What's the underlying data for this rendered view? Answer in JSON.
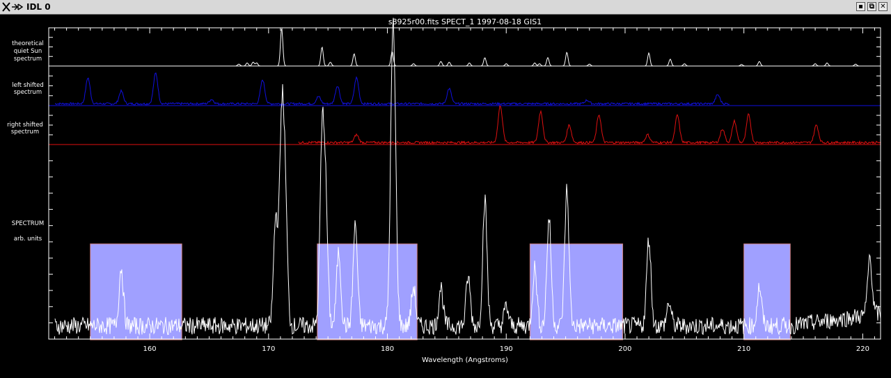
{
  "window": {
    "title": "IDL 0",
    "icon": "X-cross-window-icon",
    "buttons": [
      "minimize-icon",
      "restore-icon",
      "close-icon"
    ],
    "button_glyphs": {
      "minimize": "▪",
      "restore": "⧉",
      "close": "✕"
    }
  },
  "chart_data": {
    "type": "line",
    "title": "s8925r00.fits SPECT_1 1997-08-18 GIS1",
    "xlabel": "Wavelength (Angstroms)",
    "xlim": [
      151.5,
      221.5
    ],
    "xticks": [
      160,
      170,
      180,
      190,
      200,
      210,
      220
    ],
    "xtick_labels": [
      "160",
      "170",
      "180",
      "190",
      "200",
      "210",
      "220"
    ],
    "panels": [
      {
        "name": "theoretical",
        "label_lines": [
          "theoretical",
          "quiet Sun",
          "spectrum"
        ],
        "color": "#ffffff",
        "x_range": [
          151.5,
          221.5
        ],
        "lines": [
          [
            167.5,
            0.05
          ],
          [
            168.2,
            0.08
          ],
          [
            168.7,
            0.1
          ],
          [
            169.0,
            0.08
          ],
          [
            171.1,
            1.0
          ],
          [
            174.5,
            0.5
          ],
          [
            175.2,
            0.1
          ],
          [
            177.2,
            0.32
          ],
          [
            180.4,
            0.38
          ],
          [
            182.2,
            0.06
          ],
          [
            184.5,
            0.12
          ],
          [
            185.2,
            0.1
          ],
          [
            186.9,
            0.08
          ],
          [
            188.2,
            0.22
          ],
          [
            190.0,
            0.06
          ],
          [
            192.4,
            0.08
          ],
          [
            192.8,
            0.06
          ],
          [
            193.5,
            0.22
          ],
          [
            195.1,
            0.36
          ],
          [
            197.0,
            0.05
          ],
          [
            202.0,
            0.34
          ],
          [
            203.8,
            0.18
          ],
          [
            205.0,
            0.06
          ],
          [
            209.8,
            0.04
          ],
          [
            211.3,
            0.12
          ],
          [
            216.0,
            0.06
          ],
          [
            217.0,
            0.08
          ],
          [
            219.4,
            0.05
          ]
        ]
      },
      {
        "name": "left-shifted",
        "label_lines": [
          "left shifted",
          "spectrum"
        ],
        "color": "#1010e0",
        "x_range": [
          152.0,
          208.8
        ],
        "lines": [
          [
            154.8,
            0.72
          ],
          [
            157.6,
            0.35
          ],
          [
            160.5,
            0.85
          ],
          [
            165.2,
            0.12
          ],
          [
            169.5,
            0.66
          ],
          [
            174.2,
            0.2
          ],
          [
            175.8,
            0.5
          ],
          [
            177.4,
            0.72
          ],
          [
            185.2,
            0.42
          ],
          [
            196.8,
            0.1
          ],
          [
            207.8,
            0.25
          ]
        ]
      },
      {
        "name": "right-shifted",
        "label_lines": [
          "right shifted",
          "spectrum"
        ],
        "color": "#e01010",
        "x_range": [
          172.5,
          221.5
        ],
        "lines": [
          [
            177.4,
            0.2
          ],
          [
            189.5,
            0.95
          ],
          [
            192.9,
            0.8
          ],
          [
            195.3,
            0.45
          ],
          [
            197.8,
            0.72
          ],
          [
            201.9,
            0.2
          ],
          [
            204.4,
            0.7
          ],
          [
            208.2,
            0.35
          ],
          [
            209.2,
            0.55
          ],
          [
            210.4,
            0.72
          ],
          [
            216.1,
            0.45
          ]
        ]
      },
      {
        "name": "observed",
        "label_lines": [
          "SPECTRUM",
          "arb. units"
        ],
        "color": "#ffffff",
        "x_range": [
          152.0,
          221.5
        ],
        "lines": [
          [
            157.6,
            0.3
          ],
          [
            170.6,
            0.55
          ],
          [
            171.1,
            1.0
          ],
          [
            171.4,
            0.62
          ],
          [
            174.5,
            0.9
          ],
          [
            174.8,
            0.6
          ],
          [
            175.9,
            0.38
          ],
          [
            177.3,
            0.52
          ],
          [
            180.4,
            1.0
          ],
          [
            180.6,
            0.8
          ],
          [
            182.2,
            0.2
          ],
          [
            184.5,
            0.2
          ],
          [
            186.8,
            0.25
          ],
          [
            188.2,
            0.65
          ],
          [
            190.0,
            0.1
          ],
          [
            192.4,
            0.3
          ],
          [
            193.6,
            0.55
          ],
          [
            195.1,
            0.7
          ],
          [
            202.0,
            0.45
          ],
          [
            203.7,
            0.12
          ],
          [
            211.3,
            0.2
          ],
          [
            220.6,
            0.3
          ]
        ]
      }
    ],
    "highlight_bands": [
      {
        "from": 155.0,
        "to": 162.7,
        "color": "#a0a0ff"
      },
      {
        "from": 174.1,
        "to": 182.5,
        "color": "#a0a0ff"
      },
      {
        "from": 192.0,
        "to": 199.8,
        "color": "#a0a0ff"
      },
      {
        "from": 210.0,
        "to": 213.9,
        "color": "#a0a0ff"
      }
    ]
  }
}
